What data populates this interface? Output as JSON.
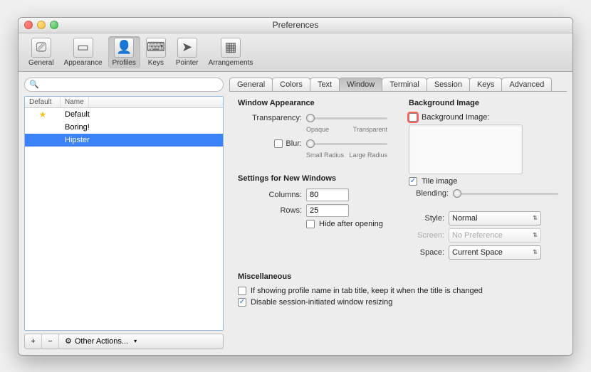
{
  "window": {
    "title": "Preferences"
  },
  "toolbar": {
    "items": [
      {
        "label": "General",
        "icon": "⎚"
      },
      {
        "label": "Appearance",
        "icon": "▭"
      },
      {
        "label": "Profiles",
        "icon": "👤"
      },
      {
        "label": "Keys",
        "icon": "⌨"
      },
      {
        "label": "Pointer",
        "icon": "➤"
      },
      {
        "label": "Arrangements",
        "icon": "▦"
      }
    ],
    "selected": 2
  },
  "sidebar": {
    "search_placeholder": "",
    "headers": {
      "col1": "Default",
      "col2": "Name"
    },
    "rows": [
      {
        "name": "Default",
        "default": true
      },
      {
        "name": "Boring!",
        "default": false
      },
      {
        "name": "Hipster",
        "default": false
      }
    ],
    "selected": 2,
    "footer": {
      "add": "+",
      "remove": "−",
      "actions_label": "Other Actions...",
      "gear": "⚙"
    }
  },
  "tabs": {
    "items": [
      "General",
      "Colors",
      "Text",
      "Window",
      "Terminal",
      "Session",
      "Keys",
      "Advanced"
    ],
    "selected": 3
  },
  "pane": {
    "section_appearance": "Window Appearance",
    "transparency_label": "Transparency:",
    "transparency_min": "Opaque",
    "transparency_max": "Transparent",
    "blur_label": "Blur:",
    "blur_min": "Small Radius",
    "blur_max": "Large Radius",
    "section_new": "Settings for New Windows",
    "columns_label": "Columns:",
    "columns_value": "80",
    "rows_label": "Rows:",
    "rows_value": "25",
    "hide_label": "Hide after opening",
    "section_bg": "Background Image",
    "bg_label": "Background Image:",
    "tile_label": "Tile image",
    "blending_label": "Blending:",
    "style_label": "Style:",
    "style_value": "Normal",
    "screen_label": "Screen:",
    "screen_value": "No Preference",
    "space_label": "Space:",
    "space_value": "Current Space",
    "section_misc": "Miscellaneous",
    "misc1": "If showing profile name in tab title, keep it when the title is changed",
    "misc2": "Disable session-initiated window resizing"
  }
}
